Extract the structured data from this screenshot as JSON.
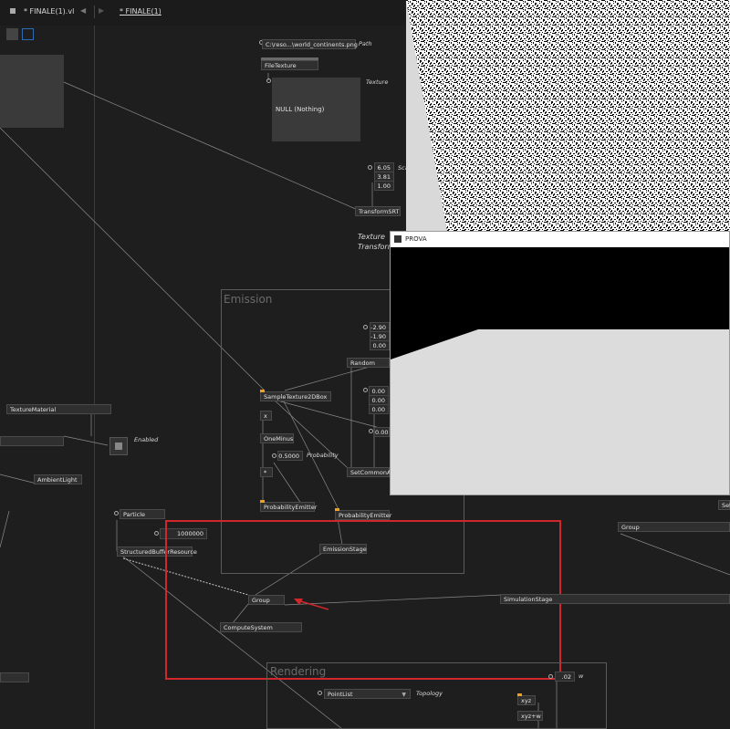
{
  "tabs": {
    "doc_tab": "* FINALE(1).vl",
    "nav_back": "◀",
    "nav_forward": "▶",
    "patch_tab": "* FINALE(1)"
  },
  "nodes": {
    "path_value": "C:\\reso...\\world_continents.png",
    "path_label": "Path",
    "file_texture": "FileTexture",
    "texture_label": "Texture",
    "texture_preview": "NULL (Nothing)",
    "scale_values": [
      "6.05",
      "3.81",
      "1.00"
    ],
    "scale_label": "Sca",
    "transform_srt": "TransformSRT",
    "texture_label_big": "Texture",
    "transform_label_big": "Transform",
    "emission_region": "Emission",
    "rendering_region": "Rendering",
    "vec_values": [
      "-2.90",
      "-1.90",
      "0.00"
    ],
    "random": "Random",
    "sample_texture": "SampleTexture2DBox",
    "x_node": "x",
    "zero_values": [
      "0.00",
      "0.00",
      "0.00"
    ],
    "one_minus": "OneMinus",
    "zero_single": "0.00",
    "probability_value": "0.5000",
    "probability_label": "Probability",
    "star_node": "*",
    "set_common": "SetCommonAt",
    "probability_emitter_1": "ProbabilityEmitter",
    "probability_emitter_2": "ProbabilityEmitter",
    "texture_material": "TextureMaterial",
    "enabled_label": "Enabled",
    "ambient_light": "AmbientLight",
    "particle": "Particle",
    "particle_count": "1000000",
    "structured_buffer": "StructuredBufferResource",
    "emission_stage": "EmissionStage",
    "group_left": "Group",
    "compute_system": "ComputeSystem",
    "group_right": "Group",
    "simulation_stage": "SimulationStage",
    "set_right": "Set",
    "w_value": ".02",
    "w_label": "w",
    "point_list": "PointList",
    "topology_label": "Topology",
    "xyz": "xyz",
    "xyzw": "xyz+w"
  },
  "window": {
    "title": "PROVA"
  },
  "colors": {
    "background": "#1e1e1e",
    "highlight": "#d0262c",
    "pin": "#f0a020"
  }
}
